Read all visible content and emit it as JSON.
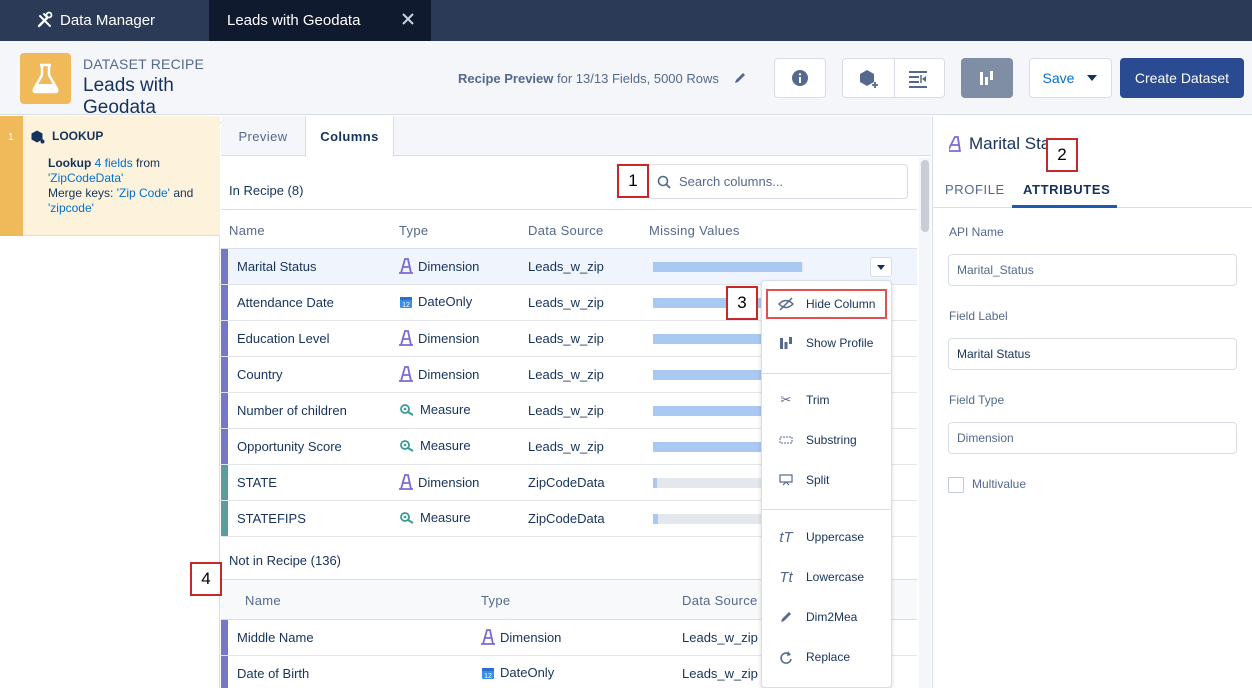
{
  "tabs": {
    "data_manager": "Data Manager",
    "active": "Leads with Geodata"
  },
  "header": {
    "subtitle": "DATASET RECIPE",
    "title": "Leads with Geodata",
    "preview_bold": "Recipe Preview",
    "preview_rest": "for 13/13 Fields, 5000 Rows",
    "save_label": "Save",
    "create_label": "Create Dataset"
  },
  "step": {
    "number": "1",
    "title": "LOOKUP",
    "lookup_word": "Lookup",
    "fields_link": "4 fields",
    "from_word": "from",
    "source": "'ZipCodeData'",
    "merge_label": "Merge keys:",
    "key1": "'Zip Code'",
    "and_word": "and",
    "key2": "'zipcode'"
  },
  "center": {
    "tab_preview": "Preview",
    "tab_columns": "Columns",
    "in_recipe": "In Recipe (8)",
    "search_placeholder": "Search columns...",
    "headers": {
      "name": "Name",
      "type": "Type",
      "source": "Data Source",
      "missing": "Missing Values"
    },
    "rows": [
      {
        "name": "Marital Status",
        "type": "Dimension",
        "source": "Leads_w_zip",
        "missing": 0.55
      },
      {
        "name": "Attendance Date",
        "type": "DateOnly",
        "source": "Leads_w_zip",
        "missing": 0.55
      },
      {
        "name": "Education Level",
        "type": "Dimension",
        "source": "Leads_w_zip",
        "missing": 0.55
      },
      {
        "name": "Country",
        "type": "Dimension",
        "source": "Leads_w_zip",
        "missing": 0.55
      },
      {
        "name": "Number of children",
        "type": "Measure",
        "source": "Leads_w_zip",
        "missing": 0.55
      },
      {
        "name": "Opportunity Score",
        "type": "Measure",
        "source": "Leads_w_zip",
        "missing": 0.55
      },
      {
        "name": "STATE",
        "type": "Dimension",
        "source": "ZipCodeData",
        "missing": 0.0
      },
      {
        "name": "STATEFIPS",
        "type": "Measure",
        "source": "ZipCodeData",
        "missing": 0.02
      }
    ],
    "not_in_recipe": "Not in Recipe (136)",
    "rows2": [
      {
        "name": "Middle Name",
        "type": "Dimension",
        "source": "Leads_w_zip"
      },
      {
        "name": "Date of Birth",
        "type": "DateOnly",
        "source": "Leads_w_zip"
      }
    ]
  },
  "menu": {
    "hide": "Hide Column",
    "profile": "Show Profile",
    "trim": "Trim",
    "substring": "Substring",
    "split": "Split",
    "upper": "Uppercase",
    "lower": "Lowercase",
    "dim2mea": "Dim2Mea",
    "replace": "Replace"
  },
  "right": {
    "title": "Marital Sta",
    "tab_profile": "PROFILE",
    "tab_attributes": "ATTRIBUTES",
    "api_label": "API Name",
    "api_value": "Marital_Status",
    "field_label_label": "Field Label",
    "field_label_value": "Marital Status",
    "field_type_label": "Field Type",
    "field_type_value": "Dimension",
    "multivalue": "Multivalue"
  },
  "callouts": [
    "1",
    "2",
    "3",
    "4"
  ],
  "colors": {
    "bar_blue": "#a9c8f2",
    "bar_gray": "#dde1e7",
    "row_purple": "#7478c6",
    "row_teal": "#5a9d9c",
    "dim_icon": "#7b6ad6",
    "measure_icon": "#3a9a96",
    "date_icon": "#3a8ee6"
  }
}
